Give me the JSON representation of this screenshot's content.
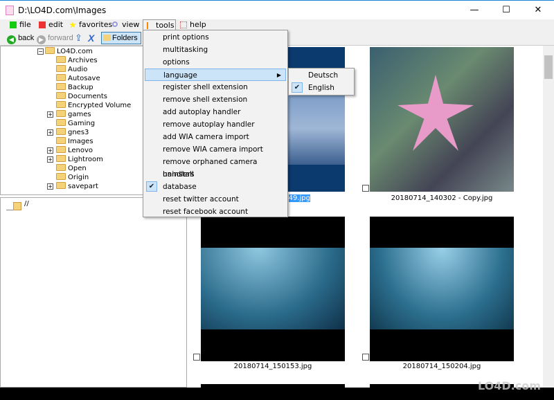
{
  "window": {
    "title": "D:\\LO4D.com\\Images",
    "minimize": "—",
    "maximize": "☐",
    "close": "✕"
  },
  "menubar": [
    {
      "label": "file"
    },
    {
      "label": "edit"
    },
    {
      "label": "favorites"
    },
    {
      "label": "view"
    },
    {
      "label": "tools"
    },
    {
      "label": "help"
    }
  ],
  "toolbar": {
    "back": "back",
    "forward": "forward",
    "folders": "Folders"
  },
  "tree": {
    "root": "LO4D.com",
    "items": [
      {
        "label": "Archives",
        "expandable": false
      },
      {
        "label": "Audio",
        "expandable": false
      },
      {
        "label": "Autosave",
        "expandable": false
      },
      {
        "label": "Backup",
        "expandable": false
      },
      {
        "label": "Documents",
        "expandable": false
      },
      {
        "label": "Encrypted Volume",
        "expandable": false
      },
      {
        "label": "games",
        "expandable": true
      },
      {
        "label": "Gaming",
        "expandable": false
      },
      {
        "label": "gnes3",
        "expandable": true
      },
      {
        "label": "Images",
        "expandable": false
      },
      {
        "label": "Lenovo",
        "expandable": true
      },
      {
        "label": "Lightroom",
        "expandable": true
      },
      {
        "label": "Open",
        "expandable": false
      },
      {
        "label": "Origin",
        "expandable": false
      },
      {
        "label": "savepart",
        "expandable": true
      }
    ]
  },
  "lower_pane": {
    "path": "//"
  },
  "tools_menu": [
    {
      "label": "print options"
    },
    {
      "label": "multitasking"
    },
    {
      "label": "options"
    },
    {
      "label": "language",
      "submenu": true,
      "highlighted": true
    },
    {
      "label": "register shell extension"
    },
    {
      "label": "remove shell extension"
    },
    {
      "label": "add autoplay handler"
    },
    {
      "label": "remove autoplay handler"
    },
    {
      "label": "add WIA camera import"
    },
    {
      "label": "remove WIA camera import"
    },
    {
      "label": "remove orphaned camera handlers"
    },
    {
      "label": "uninstall"
    },
    {
      "label": "database",
      "checked": true
    },
    {
      "label": "reset twitter account"
    },
    {
      "label": "reset facebook account"
    }
  ],
  "language_menu": [
    {
      "label": "Deutsch",
      "checked": false
    },
    {
      "label": "English",
      "checked": true
    }
  ],
  "thumbnails": [
    {
      "caption": "49.jpg",
      "selected": true
    },
    {
      "caption": "20180714_140302 - Copy.jpg"
    },
    {
      "caption": "20180714_150153.jpg"
    },
    {
      "caption": "20180714_150204.jpg"
    }
  ],
  "watermark": "LO4D.com"
}
